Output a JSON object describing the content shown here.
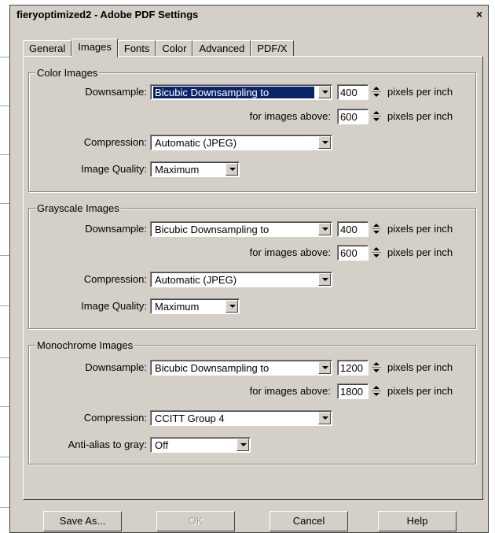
{
  "window": {
    "title": "fieryoptimized2 - Adobe PDF Settings",
    "close_label": "×"
  },
  "tabs": [
    {
      "label": "General",
      "active": false
    },
    {
      "label": "Images",
      "active": true
    },
    {
      "label": "Fonts",
      "active": false
    },
    {
      "label": "Color",
      "active": false
    },
    {
      "label": "Advanced",
      "active": false
    },
    {
      "label": "PDF/X",
      "active": false
    }
  ],
  "color_images": {
    "title": "Color Images",
    "downsample_label": "Downsample:",
    "downsample_value": "Bicubic Downsampling to",
    "resolution": "400",
    "resolution_unit": "pixels per inch",
    "above_label": "for images above:",
    "above_value": "600",
    "above_unit": "pixels per inch",
    "compression_label": "Compression:",
    "compression_value": "Automatic (JPEG)",
    "quality_label": "Image Quality:",
    "quality_value": "Maximum"
  },
  "grayscale_images": {
    "title": "Grayscale Images",
    "downsample_label": "Downsample:",
    "downsample_value": "Bicubic Downsampling to",
    "resolution": "400",
    "resolution_unit": "pixels per inch",
    "above_label": "for images above:",
    "above_value": "600",
    "above_unit": "pixels per inch",
    "compression_label": "Compression:",
    "compression_value": "Automatic (JPEG)",
    "quality_label": "Image Quality:",
    "quality_value": "Maximum"
  },
  "monochrome_images": {
    "title": "Monochrome Images",
    "downsample_label": "Downsample:",
    "downsample_value": "Bicubic Downsampling to",
    "resolution": "1200",
    "resolution_unit": "pixels per inch",
    "above_label": "for images above:",
    "above_value": "1800",
    "above_unit": "pixels per inch",
    "compression_label": "Compression:",
    "compression_value": "CCITT Group 4",
    "antialias_label": "Anti-alias to gray:",
    "antialias_value": "Off"
  },
  "buttons": {
    "save_as": "Save As...",
    "ok": "OK",
    "cancel": "Cancel",
    "help": "Help"
  }
}
